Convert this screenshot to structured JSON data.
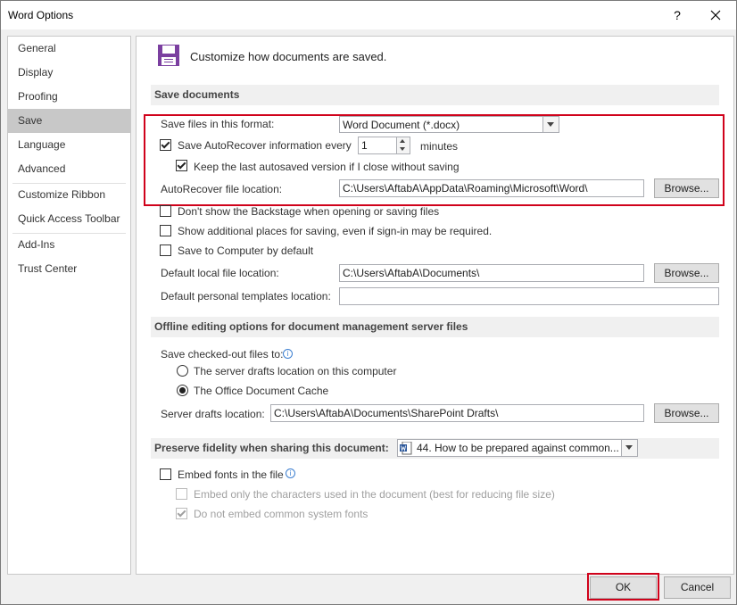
{
  "window": {
    "title": "Word Options",
    "help_glyph": "?"
  },
  "sidebar": {
    "items": [
      {
        "label": "General"
      },
      {
        "label": "Display"
      },
      {
        "label": "Proofing"
      },
      {
        "label": "Save"
      },
      {
        "label": "Language"
      },
      {
        "label": "Advanced"
      },
      {
        "label": "Customize Ribbon"
      },
      {
        "label": "Quick Access Toolbar"
      },
      {
        "label": "Add-Ins"
      },
      {
        "label": "Trust Center"
      }
    ],
    "active": "Save"
  },
  "header": {
    "title": "Customize how documents are saved."
  },
  "save_documents": {
    "section_title": "Save documents",
    "format_label": "Save files in this format:",
    "format_value": "Word Document (*.docx)",
    "autorecover_label": "Save AutoRecover information every",
    "autorecover_minutes": "1",
    "minutes_label": "minutes",
    "keep_last_label": "Keep the last autosaved version if I close without saving",
    "autorecover_location_label": "AutoRecover file location:",
    "autorecover_location_value": "C:\\Users\\AftabA\\AppData\\Roaming\\Microsoft\\Word\\",
    "browse_label": "Browse...",
    "dont_show_backstage_label": "Don't show the Backstage when opening or saving files",
    "show_additional_places_label": "Show additional places for saving, even if sign-in may be required.",
    "save_to_computer_label": "Save to Computer by default",
    "default_local_label": "Default local file location:",
    "default_local_value": "C:\\Users\\AftabA\\Documents\\",
    "default_templates_label": "Default personal templates location:",
    "default_templates_value": ""
  },
  "offline": {
    "section_title": "Offline editing options for document management server files",
    "checked_out_label": "Save checked-out files to:",
    "radio_server_label": "The server drafts location on this computer",
    "radio_cache_label": "The Office Document Cache",
    "server_drafts_label": "Server drafts location:",
    "server_drafts_value": "C:\\Users\\AftabA\\Documents\\SharePoint Drafts\\",
    "browse_label": "Browse..."
  },
  "fidelity": {
    "section_title": "Preserve fidelity when sharing this document:",
    "document_value": "44. How to be prepared against common...",
    "embed_fonts_label": "Embed fonts in the file",
    "embed_only_label": "Embed only the characters used in the document (best for reducing file size)",
    "do_not_embed_label": "Do not embed common system fonts"
  },
  "footer": {
    "ok_label": "OK",
    "cancel_label": "Cancel"
  },
  "colors": {
    "highlight_border": "#d0021b",
    "accent_icon": "#7b3fa0",
    "info_icon": "#3c7fd0"
  }
}
